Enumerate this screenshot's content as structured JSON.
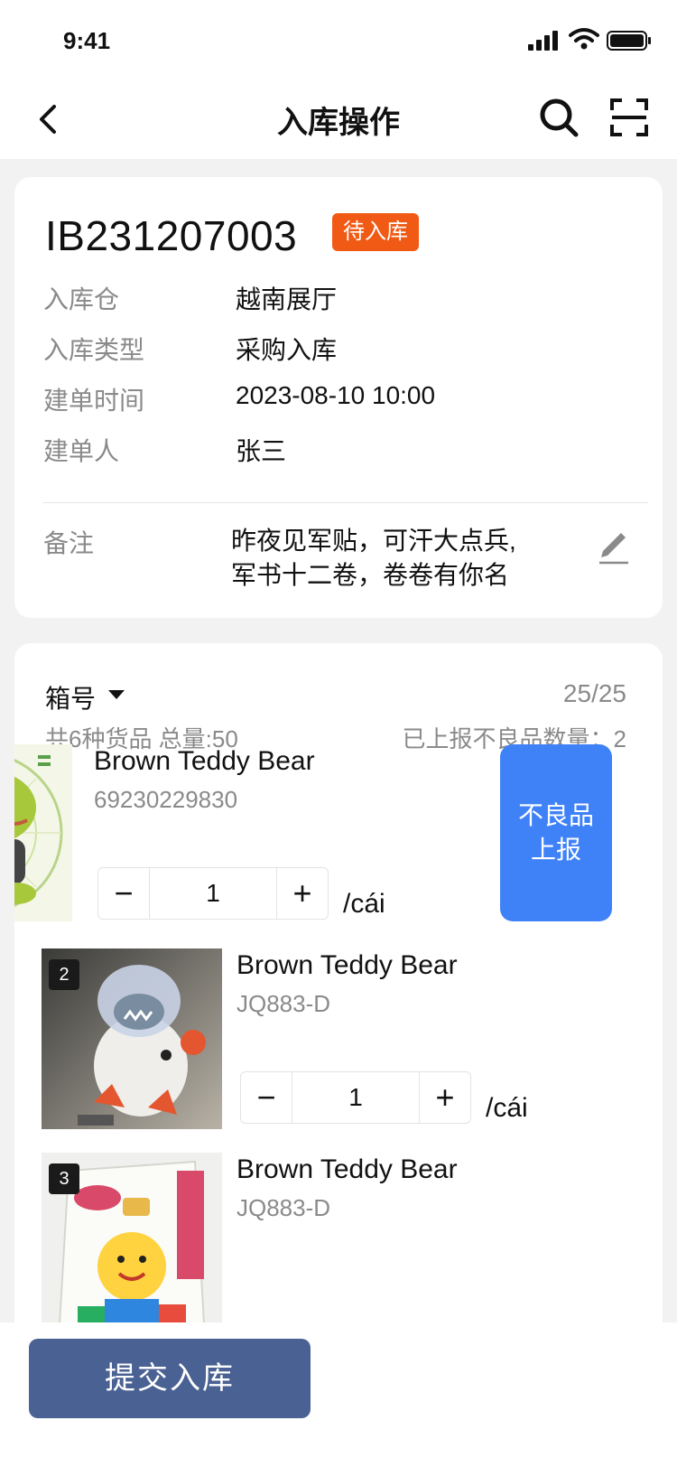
{
  "status_bar": {
    "time": "9:41"
  },
  "nav": {
    "title": "入库操作"
  },
  "order": {
    "id": "IB231207003",
    "status": "待入库",
    "status_color": "#f05a14",
    "fields": [
      {
        "label": "入库仓",
        "value": "越南展厅"
      },
      {
        "label": "入库类型",
        "value": "采购入库"
      },
      {
        "label": "建单时间",
        "value": "2023-08-10 10:00"
      },
      {
        "label": "建单人",
        "value": "张三"
      }
    ],
    "remark_label": "备注",
    "remark_line1": "昨夜见军贴，可汗大点兵,",
    "remark_line2": "军书十二卷，卷卷有你名"
  },
  "box": {
    "label": "箱号",
    "count": "25/25",
    "summary": "共6种货品 总量:50",
    "defect_reported": "已上报不良品数量：2"
  },
  "products": [
    {
      "name": "Brown Teddy Bear",
      "code": "69230229830",
      "qty": "1",
      "unit": "/cái",
      "defect_line1": "不良品",
      "defect_line2": "上报"
    },
    {
      "index": "2",
      "name": "Brown Teddy Bear",
      "code": "JQ883-D",
      "qty": "1",
      "unit": "/cái"
    },
    {
      "index": "3",
      "name": "Brown Teddy Bear",
      "code": "JQ883-D"
    }
  ],
  "submit_label": "提交入库",
  "colors": {
    "accent_blue": "#3f82f7",
    "submit_bg": "#4a6193"
  }
}
